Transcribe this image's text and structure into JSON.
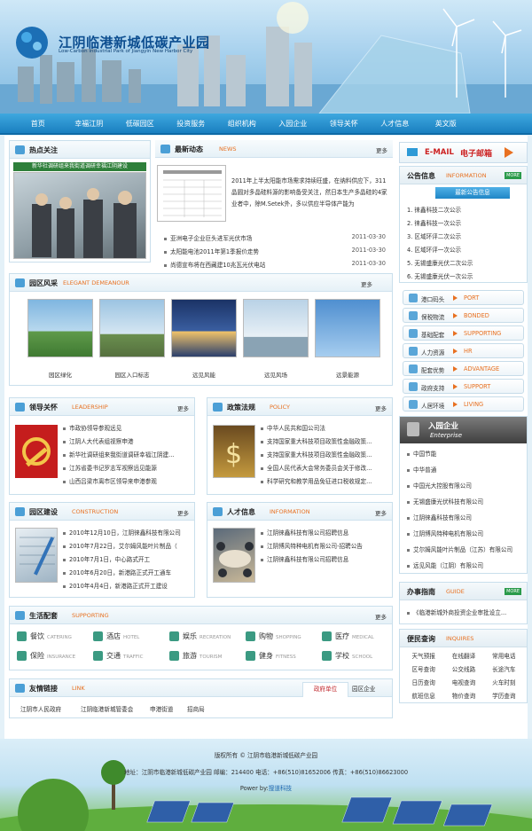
{
  "site": {
    "name_cn": "江阴临港新城低碳产业园",
    "name_en1": "Low-Carbon Industrial Park of Jiangyin",
    "name_en2": "New Harbor City"
  },
  "nav": [
    "首页",
    "幸福江阴",
    "低碳园区",
    "投资服务",
    "组织机构",
    "入园企业",
    "领导关怀",
    "人才信息",
    "英文版"
  ],
  "hot": {
    "title": "热点关注",
    "caption": "新华社调研组来我街道调研幸福江阴建设"
  },
  "news": {
    "title": "最新动态",
    "en": "NEWS",
    "more": "更多",
    "lead": "2011年上半太阳能市场需求持续旺盛，在纳料供应下，311晶圆对多晶硅料源的影响备受关注，然日本生产多晶硅的4家业者中，除M.Setek外，多以供应半导体产能为",
    "items": [
      {
        "t": "亚洲电子企业巨头进军光伏市场",
        "d": "2011-03-30"
      },
      {
        "t": "太阳能电池2011年第1季报价走势",
        "d": "2011-03-30"
      },
      {
        "t": "尚德宣布将在西藏建10兆瓦光伏电站",
        "d": "2011-03-30"
      }
    ]
  },
  "email": {
    "en": "E-MAIL",
    "cn": "电子邮箱"
  },
  "notice": {
    "title": "公告信息",
    "en": "INFORMATION",
    "more": "MORE",
    "tab": "最新公告信息",
    "items": [
      "徕鑫科技二次公示",
      "徕鑫科技一次公示",
      "区域环评二次公示",
      "区域环评一次公示",
      "无锡盛康光伏二次公示",
      "无锡盛康光伏一次公示"
    ]
  },
  "service": [
    {
      "cn": "港口码头",
      "en": "PORT"
    },
    {
      "cn": "保税物流",
      "en": "BONDED"
    },
    {
      "cn": "基础配套",
      "en": "SUPPORTING"
    },
    {
      "cn": "人力资源",
      "en": "HR"
    },
    {
      "cn": "配套优势",
      "en": "ADVANTAGE"
    },
    {
      "cn": "政府支持",
      "en": "SUPPORT"
    },
    {
      "cn": "人居环境",
      "en": "LIVING"
    }
  ],
  "style": {
    "title": "园区风采",
    "en": "ELEGANT DEMEANOUR",
    "more": "更多",
    "caps": [
      "园区绿化",
      "园区入口标志",
      "远见风能",
      "远见风场",
      "远景能源"
    ]
  },
  "leader": {
    "title": "领导关怀",
    "en": "LEADERSHIP",
    "more": "更多",
    "items": [
      "市政协领导参观远见",
      "江阴人大代表组视察申港",
      "新华社调研组来我街道调研幸福江阴建...",
      "江苏省委书记罗志军视察远见能源",
      "山西吕梁市离市区领导来申港参观"
    ]
  },
  "policy": {
    "title": "政策法规",
    "en": "POLICY",
    "more": "更多",
    "items": [
      "中华人民共和国公司法",
      "支持国家重大科技项目政策性金融政策...",
      "支持国家重大科技项目政策性金融政策...",
      "全国人民代表大会常务委员会关于修改...",
      "科学研究和教学用品免征进口税收规定..."
    ]
  },
  "build": {
    "title": "园区建设",
    "en": "CONSTRUCTION",
    "more": "更多",
    "items": [
      "2010年12月10日，江阴徕鑫科技有限公司",
      "2010年7月22日，艾尔姆风能叶片制品（",
      "2010年7月1日，中心路式开工",
      "2010年6月20日，新港路正式开工通车",
      "2010年4月4日，新港路正式开工建设"
    ]
  },
  "talent": {
    "title": "人才信息",
    "en": "INFORMATION",
    "more": "更多",
    "items": [
      "江阴徕鑫科技有限公司招聘信息",
      "江阴博风特种电机有限公司-招聘公告",
      "江阴徕鑫科技有限公司招聘信息"
    ]
  },
  "enterprise": {
    "title": "入园企业",
    "en": "Enterprise",
    "items": [
      "中国节能",
      "中华普通",
      "中国光大控股有限公司",
      "无锡盛康光伏科技有限公司",
      "江阴徕鑫科技有限公司",
      "江阴博风特种电机有限公司",
      "艾尔姆风能叶片制品（江苏）有限公司",
      "远见风能（江阴）有限公司"
    ]
  },
  "guide": {
    "title": "办事指南",
    "en": "GUIDE",
    "more": "MORE",
    "item": "《临港新城外商投资企业审批设立..."
  },
  "life": {
    "title": "生活配套",
    "en": "SUPPORTING",
    "more": "更多",
    "items": [
      {
        "cn": "餐饮",
        "en": "CATERING"
      },
      {
        "cn": "酒店",
        "en": "HOTEL"
      },
      {
        "cn": "娱乐",
        "en": "RECREATION"
      },
      {
        "cn": "购物",
        "en": "SHOPPING"
      },
      {
        "cn": "医疗",
        "en": "MEDICAL"
      },
      {
        "cn": "保险",
        "en": "INSURANCE"
      },
      {
        "cn": "交通",
        "en": "TRAFFIC"
      },
      {
        "cn": "旅游",
        "en": "TOURISM"
      },
      {
        "cn": "健身",
        "en": "FITNESS"
      },
      {
        "cn": "学校",
        "en": "SCHOOL"
      }
    ]
  },
  "inquire": {
    "title": "便民查询",
    "en": "INQUIRES",
    "items": [
      "天气预报",
      "在线翻译",
      "常用电话",
      "区号查询",
      "公交线路",
      "长途汽车",
      "日历查询",
      "电视查询",
      "火车时刻",
      "航班信息",
      "物价查询",
      "学历查询"
    ]
  },
  "links": {
    "title": "友情链接",
    "en": "LINK",
    "tab1": "政府单位",
    "tab2": "园区企业",
    "items": [
      "江阴市人民政府",
      "江阴临港新城管委会",
      "申港街道",
      "招商局"
    ]
  },
  "footer": {
    "copy": "版权所有 © 江阴市临港新城低碳产业园",
    "addr": "地址：江阴市临港新城低碳产业园 邮编：214400 电话：+86(510)81652006 传真：+86(510)86623000",
    "power": "Power by:",
    "powerby": "搜道科技"
  },
  "colors": {
    "nav": "#1a7fc0",
    "accent": "#e87020"
  }
}
